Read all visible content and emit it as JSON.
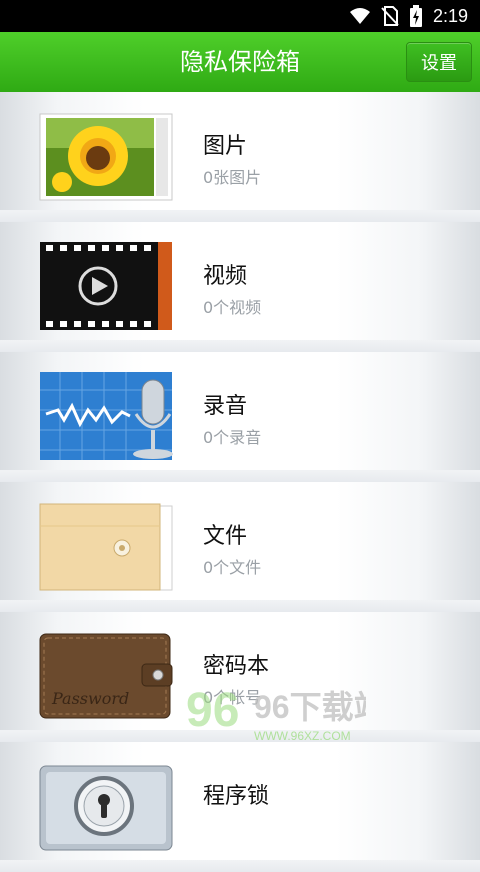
{
  "status_bar": {
    "time": "2:19"
  },
  "header": {
    "title": "隐私保险箱",
    "settings_label": "设置"
  },
  "items": [
    {
      "name": "图片",
      "count": "0张图片",
      "icon": "photo-icon"
    },
    {
      "name": "视频",
      "count": "0个视频",
      "icon": "video-icon"
    },
    {
      "name": "录音",
      "count": "0个录音",
      "icon": "microphone-icon"
    },
    {
      "name": "文件",
      "count": "0个文件",
      "icon": "envelope-icon"
    },
    {
      "name": "密码本",
      "count": "0个帐号",
      "icon": "wallet-icon"
    },
    {
      "name": "程序锁",
      "count": "",
      "icon": "lock-icon"
    }
  ],
  "wallet_text": "Password",
  "watermark": {
    "text": "96下载站",
    "url": "WWW.96XZ.COM"
  },
  "colors": {
    "header": "#3cbf1f",
    "status": "#000000"
  }
}
